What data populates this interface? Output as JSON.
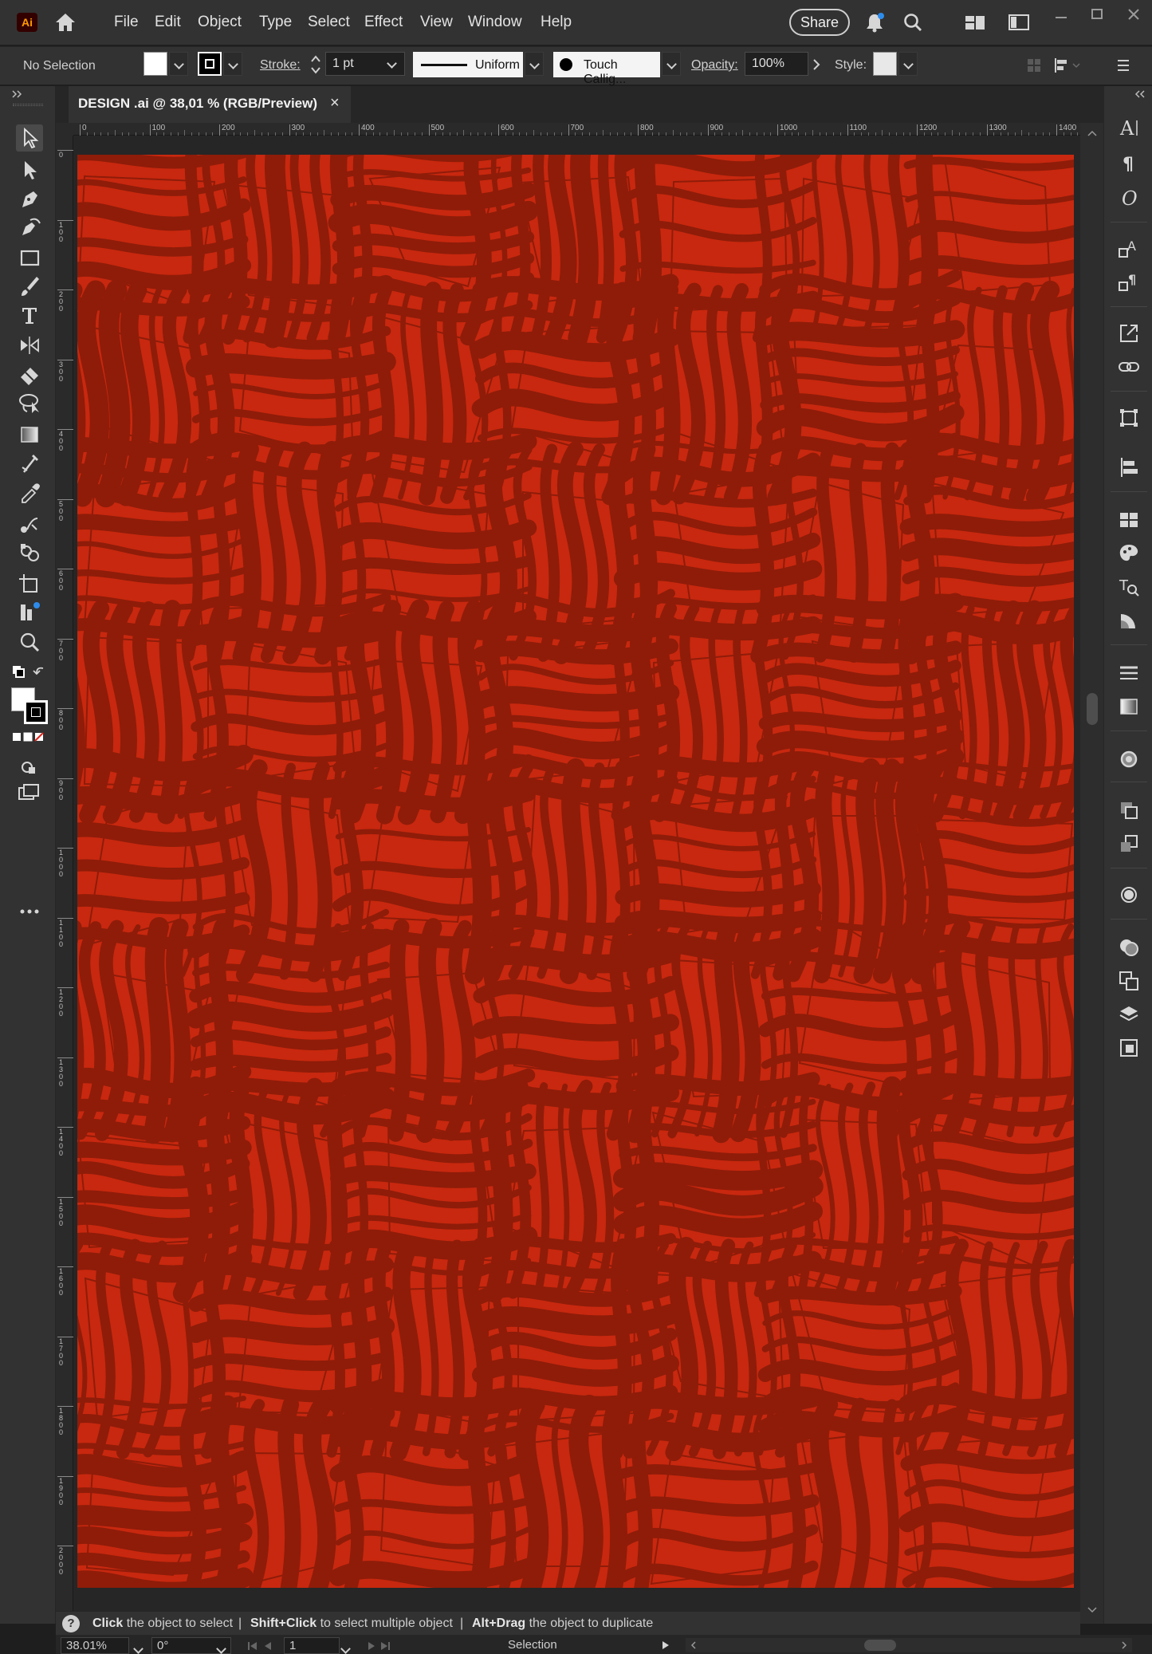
{
  "app": {
    "logo": "Ai",
    "menu": [
      "File",
      "Edit",
      "Object",
      "Type",
      "Select",
      "Effect",
      "View",
      "Window",
      "Help"
    ],
    "share_label": "Share"
  },
  "control_bar": {
    "selection_label": "No Selection",
    "stroke_label": "Stroke:",
    "stroke_weight": "1 pt",
    "profile_label": "Uniform",
    "brush_label": "Touch Callig...",
    "opacity_label": "Opacity:",
    "opacity_value": "100%",
    "style_label": "Style:"
  },
  "document": {
    "tab_title": "DESIGN .ai @ 38,01 % (RGB/Preview)",
    "close_glyph": "×"
  },
  "ruler": {
    "h_ticks": [
      "0",
      "100",
      "200",
      "300",
      "400",
      "500",
      "600",
      "700",
      "800",
      "900",
      "1000",
      "1100",
      "1200",
      "1300",
      "1400"
    ],
    "v_ticks": [
      "0",
      "100",
      "200",
      "300",
      "400",
      "500",
      "600",
      "700",
      "800",
      "900",
      "1000",
      "1100",
      "1200",
      "1300",
      "1400",
      "1500",
      "1600",
      "1700",
      "1800",
      "1900",
      "2000"
    ]
  },
  "hint_bar": {
    "icon": "?",
    "seg1_bold": "Click",
    "seg1_text": "the object to select",
    "seg2_bold": "Shift+Click",
    "seg2_text": "to select multiple object",
    "seg3_bold": "Alt+Drag",
    "seg3_text": "the object to duplicate",
    "separator": "|"
  },
  "status_bar": {
    "zoom": "38.01%",
    "rotation": "0°",
    "artboard": "1",
    "tool": "Selection"
  },
  "colors": {
    "artboard_base": "#c8280f",
    "artboard_pattern": "#8e1c09",
    "ui_bg": "#323232",
    "accent_dot": "#2d8ceb"
  },
  "icons": {
    "toolbar": [
      "selection-tool-icon",
      "direct-selection-tool-icon",
      "pen-tool-icon",
      "curvature-tool-icon",
      "rectangle-tool-icon",
      "paintbrush-tool-icon",
      "type-tool-icon",
      "reflect-tool-icon",
      "eraser-tool-icon",
      "lasso-tool-icon",
      "gradient-tool-icon",
      "mesh-tool-icon",
      "eyedropper-tool-icon",
      "blend-tool-icon",
      "shape-builder-tool-icon",
      "artboard-tool-icon",
      "graph-tool-icon",
      "zoom-tool-icon"
    ],
    "right_panel": [
      "character-panel-icon",
      "paragraph-panel-icon",
      "opentype-panel-icon",
      "character-styles-icon",
      "paragraph-styles-icon",
      "export-icon",
      "links-icon",
      "transform-panel-icon",
      "align-panel-icon",
      "swatches-panel-icon",
      "color-panel-icon",
      "type-on-path-icon",
      "color-guide-icon",
      "stroke-panel-icon",
      "gradient-panel-icon",
      "appearance-panel-icon",
      "symbols-panel-icon",
      "graphic-styles-icon",
      "brushes-panel-icon",
      "pathfinder-panel-icon",
      "transparency-panel-icon",
      "layers-panel-icon",
      "artboards-panel-icon"
    ]
  }
}
